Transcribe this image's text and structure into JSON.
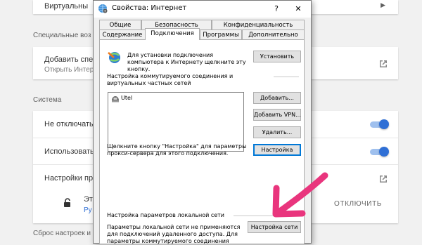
{
  "background": {
    "rows_top": {
      "vpn_label": "Виртуальны"
    },
    "section_special": "Специальные воз",
    "special_row": {
      "title": "Добавить спец",
      "link": "Открыть Интер"
    },
    "section_system": "Система",
    "system_rows": [
      {
        "label": "Не отключать"
      },
      {
        "label": "Использовать"
      },
      {
        "label": "Настройки пр"
      }
    ],
    "extension_row": {
      "name": "Эт",
      "link": "Ру",
      "off_button": "ОТКЛЮЧИТЬ"
    },
    "section_reset": "Сброс настроек и"
  },
  "dialog": {
    "title": "Свойства: Интернет",
    "help_label": "?",
    "close_label": "✕",
    "tabs_row1": [
      "Общие",
      "Безопасность",
      "Конфиденциальность"
    ],
    "tabs_row2": [
      "Содержание",
      "Подключения",
      "Программы",
      "Дополнительно"
    ],
    "active_tab": "Подключения",
    "setup_text": "Для установки подключения компьютера к Интернету щелкните эту кнопку.",
    "setup_button": "Установить",
    "dialup_header": "Настройка коммутируемого соединения и виртуальных частных сетей",
    "connections": [
      "Utel"
    ],
    "add_button": "Добавить...",
    "add_vpn_button": "Добавить VPN...",
    "remove_button": "Удалить...",
    "settings_text": "Щелкните кнопку \"Настройка\" для параметры прокси-сервера для этого подключения.",
    "settings_button": "Настройка",
    "lan_header": "Настройка параметров локальной сети",
    "lan_text": "Параметры локальной сети не применяются для подключений удаленного доступа. Для параметры коммутируемого соединения",
    "lan_button": "Настройка сети"
  },
  "colors": {
    "accent": "#2f6fd5",
    "arrow": "#e9357d",
    "default_button_border": "#0078d7"
  }
}
